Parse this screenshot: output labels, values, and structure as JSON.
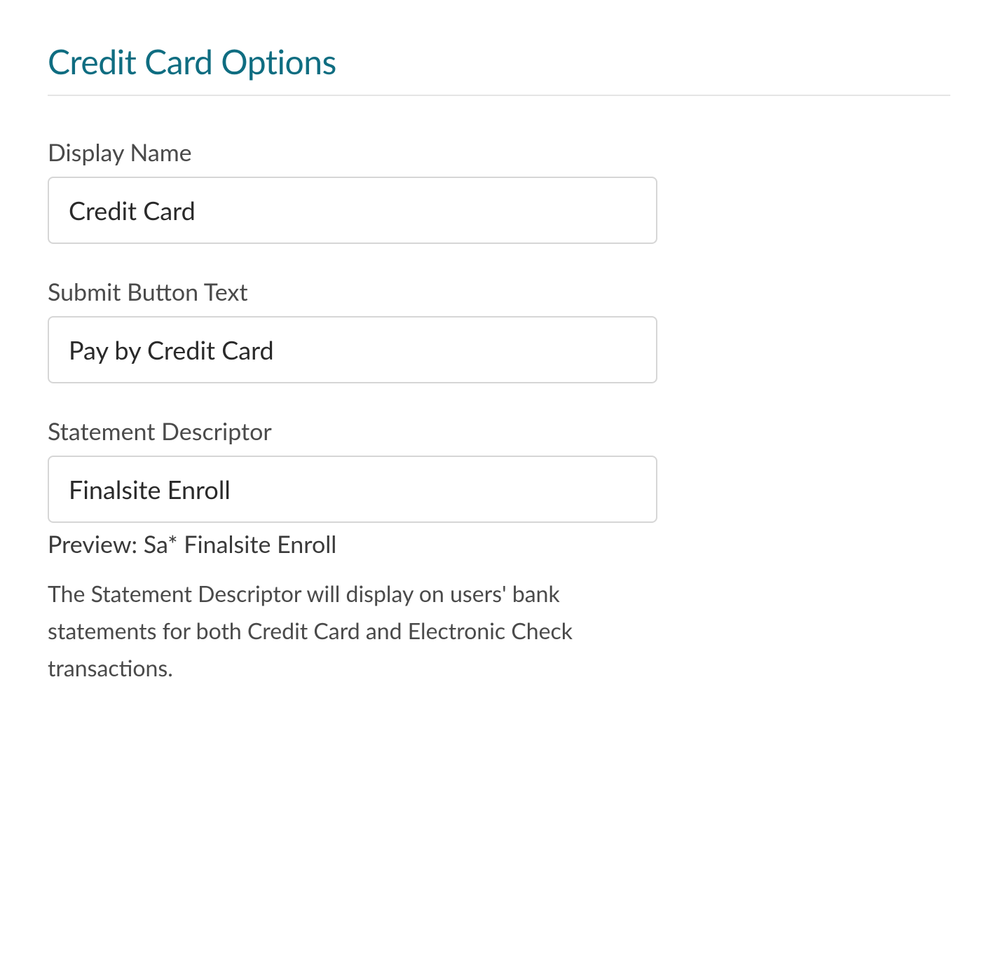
{
  "section": {
    "title": "Credit Card Options"
  },
  "fields": {
    "displayName": {
      "label": "Display Name",
      "value": "Credit Card"
    },
    "submitButtonText": {
      "label": "Submit Button Text",
      "value": "Pay by Credit Card"
    },
    "statementDescriptor": {
      "label": "Statement Descriptor",
      "value": "Finalsite Enroll",
      "preview": "Preview: Sa* Finalsite Enroll",
      "help": "The Statement Descriptor will display on users' bank statements for both Credit Card and Electronic Check transactions."
    }
  }
}
